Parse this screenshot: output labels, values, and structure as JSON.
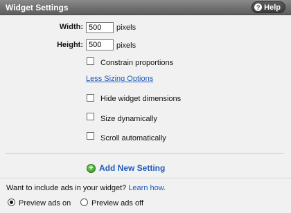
{
  "header": {
    "title": "Widget Settings",
    "help_label": "Help"
  },
  "size": {
    "width_label": "Width:",
    "width_value": "500",
    "width_unit": "pixels",
    "height_label": "Height:",
    "height_value": "500",
    "height_unit": "pixels"
  },
  "options": {
    "constrain_label": "Constrain proportions",
    "less_sizing_link": "Less Sizing Options",
    "hide_dimensions_label": "Hide widget dimensions",
    "size_dynamically_label": "Size dynamically",
    "scroll_auto_label": "Scroll automatically"
  },
  "add_setting": {
    "icon": "+",
    "label": "Add New Setting"
  },
  "ads": {
    "question": "Want to include ads in your widget?",
    "learn_link": "Learn how.",
    "preview_on_label": "Preview ads on",
    "preview_off_label": "Preview ads off",
    "selected": "on"
  },
  "colors": {
    "link": "#1f5bb8",
    "header": "#6f6f6f",
    "background": "#f1f1f1"
  }
}
